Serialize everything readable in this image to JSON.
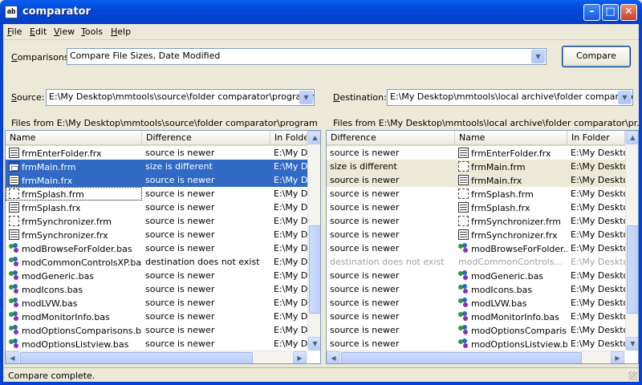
{
  "window": {
    "title": "comparator",
    "app_icon_text": "ab"
  },
  "titlebar_buttons": {
    "minimize": "–",
    "maximize": "□",
    "close": "✕"
  },
  "menu": [
    {
      "key": "F",
      "rest": "ile"
    },
    {
      "key": "E",
      "rest": "dit"
    },
    {
      "key": "V",
      "rest": "iew"
    },
    {
      "key": "T",
      "rest": "ools"
    },
    {
      "key": "H",
      "rest": "elp"
    }
  ],
  "comparisons": {
    "label_key": "C",
    "label_rest": "omparisons:",
    "value": "Compare File Sizes, Date Modified"
  },
  "compare_button": "Compare",
  "source": {
    "label_key": "S",
    "label_rest": "ource:",
    "path": "E:\\My Desktop\\mmtools\\source\\folder comparator\\programming\\",
    "files_label": "Files from E:\\My Desktop\\mmtools\\source\\folder comparator\\program...\\source",
    "columns": [
      "Name",
      "Difference",
      "In Folder"
    ],
    "rows": [
      {
        "name": "frmEnterFolder.frx",
        "diff": "source is newer",
        "folder": "E:\\My Desktop",
        "icon": "frx",
        "state": ""
      },
      {
        "name": "frmMain.frm",
        "diff": "size is different",
        "folder": "E:\\My Desktop",
        "icon": "form",
        "state": "sel"
      },
      {
        "name": "frmMain.frx",
        "diff": "source is newer",
        "folder": "E:\\My Desktop",
        "icon": "frx",
        "state": "sel"
      },
      {
        "name": "frmSplash.frm",
        "diff": "source is newer",
        "folder": "E:\\My Desktop",
        "icon": "outline",
        "state": "focus"
      },
      {
        "name": "frmSplash.frx",
        "diff": "source is newer",
        "folder": "E:\\My Desktop",
        "icon": "frx",
        "state": ""
      },
      {
        "name": "frmSynchronizer.frm",
        "diff": "source is newer",
        "folder": "E:\\My Desktop",
        "icon": "outline",
        "state": ""
      },
      {
        "name": "frmSynchronizer.frx",
        "diff": "source is newer",
        "folder": "E:\\My Desktop",
        "icon": "frx",
        "state": ""
      },
      {
        "name": "modBrowseForFolder.bas",
        "diff": "source is newer",
        "folder": "E:\\My Desktop",
        "icon": "bas",
        "state": ""
      },
      {
        "name": "modCommonControlsXP.bas",
        "diff": "destination does not exist",
        "folder": "E:\\My Desktop",
        "icon": "bas",
        "state": ""
      },
      {
        "name": "modGeneric.bas",
        "diff": "source is newer",
        "folder": "E:\\My Desktop",
        "icon": "bas",
        "state": ""
      },
      {
        "name": "modIcons.bas",
        "diff": "source is newer",
        "folder": "E:\\My Desktop",
        "icon": "bas",
        "state": ""
      },
      {
        "name": "modLVW.bas",
        "diff": "source is newer",
        "folder": "E:\\My Desktop",
        "icon": "bas",
        "state": ""
      },
      {
        "name": "modMonitorInfo.bas",
        "diff": "source is newer",
        "folder": "E:\\My Desktop",
        "icon": "bas",
        "state": ""
      },
      {
        "name": "modOptionsComparisons.bas",
        "diff": "source is newer",
        "folder": "E:\\My Desktop",
        "icon": "bas",
        "state": ""
      },
      {
        "name": "modOptionsListview.bas",
        "diff": "source is newer",
        "folder": "E:\\My Desktop",
        "icon": "bas",
        "state": ""
      }
    ]
  },
  "destination": {
    "label_key": "D",
    "label_rest": "estination:",
    "path": "E:\\My Desktop\\mmtools\\local archive\\folder comparator\\programming\\",
    "files_label": "Files from E:\\My Desktop\\mmtools\\local archive\\folder comparator\\pr...\\source",
    "columns": [
      "Difference",
      "Name",
      "In Folder"
    ],
    "rows": [
      {
        "diff": "source is newer",
        "name": "frmEnterFolder.frx",
        "folder": "E:\\My Desktop",
        "icon": "frx",
        "state": ""
      },
      {
        "diff": "size is different",
        "name": "frmMain.frm",
        "folder": "E:\\My Desktop",
        "icon": "outline",
        "state": "shade"
      },
      {
        "diff": "source is newer",
        "name": "frmMain.frx",
        "folder": "E:\\My Desktop",
        "icon": "frx",
        "state": "shade"
      },
      {
        "diff": "source is newer",
        "name": "frmSplash.frm",
        "folder": "E:\\My Desktop",
        "icon": "outline",
        "state": ""
      },
      {
        "diff": "source is newer",
        "name": "frmSplash.frx",
        "folder": "E:\\My Desktop",
        "icon": "frx",
        "state": ""
      },
      {
        "diff": "source is newer",
        "name": "frmSynchronizer.frm",
        "folder": "E:\\My Desktop",
        "icon": "outline",
        "state": ""
      },
      {
        "diff": "source is newer",
        "name": "frmSynchronizer.frx",
        "folder": "E:\\My Desktop",
        "icon": "frx",
        "state": ""
      },
      {
        "diff": "source is newer",
        "name": "modBrowseForFolder...",
        "folder": "E:\\My Desktop",
        "icon": "bas",
        "state": ""
      },
      {
        "diff": "destination does not exist",
        "name": "modCommonControls...",
        "folder": "E:\\My Desktop",
        "icon": "none",
        "state": "dim"
      },
      {
        "diff": "source is newer",
        "name": "modGeneric.bas",
        "folder": "E:\\My Desktop",
        "icon": "bas",
        "state": ""
      },
      {
        "diff": "source is newer",
        "name": "modIcons.bas",
        "folder": "E:\\My Desktop",
        "icon": "bas",
        "state": ""
      },
      {
        "diff": "source is newer",
        "name": "modLVW.bas",
        "folder": "E:\\My Desktop",
        "icon": "bas",
        "state": ""
      },
      {
        "diff": "source is newer",
        "name": "modMonitorInfo.bas",
        "folder": "E:\\My Desktop",
        "icon": "bas",
        "state": ""
      },
      {
        "diff": "source is newer",
        "name": "modOptionsComparis...",
        "folder": "E:\\My Desktop",
        "icon": "bas",
        "state": ""
      },
      {
        "diff": "source is newer",
        "name": "modOptionsListview.bas",
        "folder": "E:\\My Desktop",
        "icon": "bas",
        "state": ""
      }
    ]
  },
  "scroll_arrows": {
    "up": "▲",
    "down": "▼",
    "left": "◀",
    "right": "▶",
    "combo": "▼"
  },
  "status": "Compare complete.",
  "colors": {
    "selection": "#316ac5",
    "title_bar": "#0148d8",
    "face": "#ece9d8",
    "dim_text": "#a0a0a0"
  }
}
